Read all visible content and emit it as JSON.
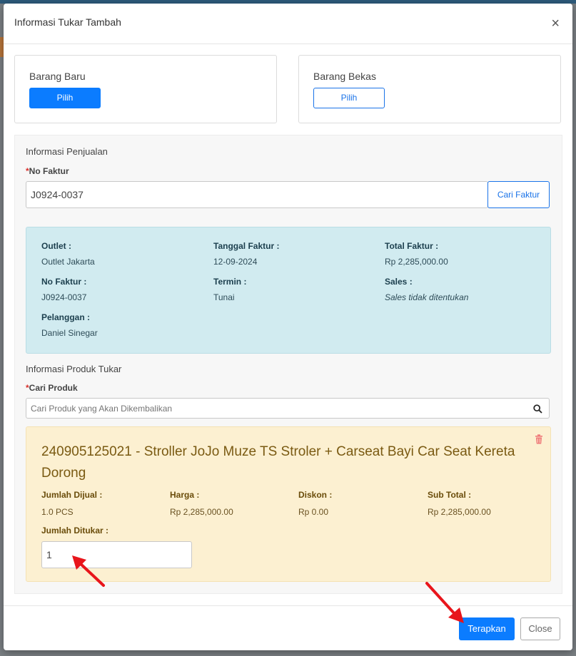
{
  "modal": {
    "title": "Informasi Tukar Tambah",
    "close_symbol": "×"
  },
  "new_item": {
    "label": "Barang Baru",
    "button": "Pilih"
  },
  "used_item": {
    "label": "Barang Bekas",
    "button": "Pilih"
  },
  "sales_info": {
    "section_title": "Informasi Penjualan",
    "invoice_label": "No Faktur",
    "invoice_value": "J0924-0037",
    "search_button": "Cari Faktur",
    "details": {
      "outlet_label": "Outlet :",
      "outlet_value": "Outlet Jakarta",
      "invoice_date_label": "Tanggal Faktur :",
      "invoice_date_value": "12-09-2024",
      "total_label": "Total Faktur :",
      "total_value": "Rp 2,285,000.00",
      "invoice_no_label": "No Faktur :",
      "invoice_no_value": "J0924-0037",
      "term_label": "Termin :",
      "term_value": "Tunai",
      "sales_label": "Sales :",
      "sales_value": "Sales tidak ditentukan",
      "customer_label": "Pelanggan :",
      "customer_value": "Daniel Sinegar"
    }
  },
  "exchange": {
    "section_title": "Informasi Produk Tukar",
    "search_label": "Cari Produk",
    "search_placeholder": "Cari Produk yang Akan Dikembalikan",
    "product": {
      "title": "240905125021 - Stroller JoJo Muze TS Stroler + Carseat Bayi Car Seat Kereta Dorong",
      "sold_label": "Jumlah Dijual :",
      "sold_value": "1.0 PCS",
      "price_label": "Harga :",
      "price_value": "Rp 2,285,000.00",
      "discount_label": "Diskon :",
      "discount_value": "Rp 0.00",
      "subtotal_label": "Sub Total :",
      "subtotal_value": "Rp 2,285,000.00",
      "qty_label": "Jumlah Ditukar :",
      "qty_value": "1"
    }
  },
  "footer": {
    "apply": "Terapkan",
    "close": "Close"
  },
  "colors": {
    "primary": "#0b7cff",
    "info_bg": "#d1ebf0",
    "warning_bg": "#fcf0d1",
    "arrow": "#e8151b"
  }
}
